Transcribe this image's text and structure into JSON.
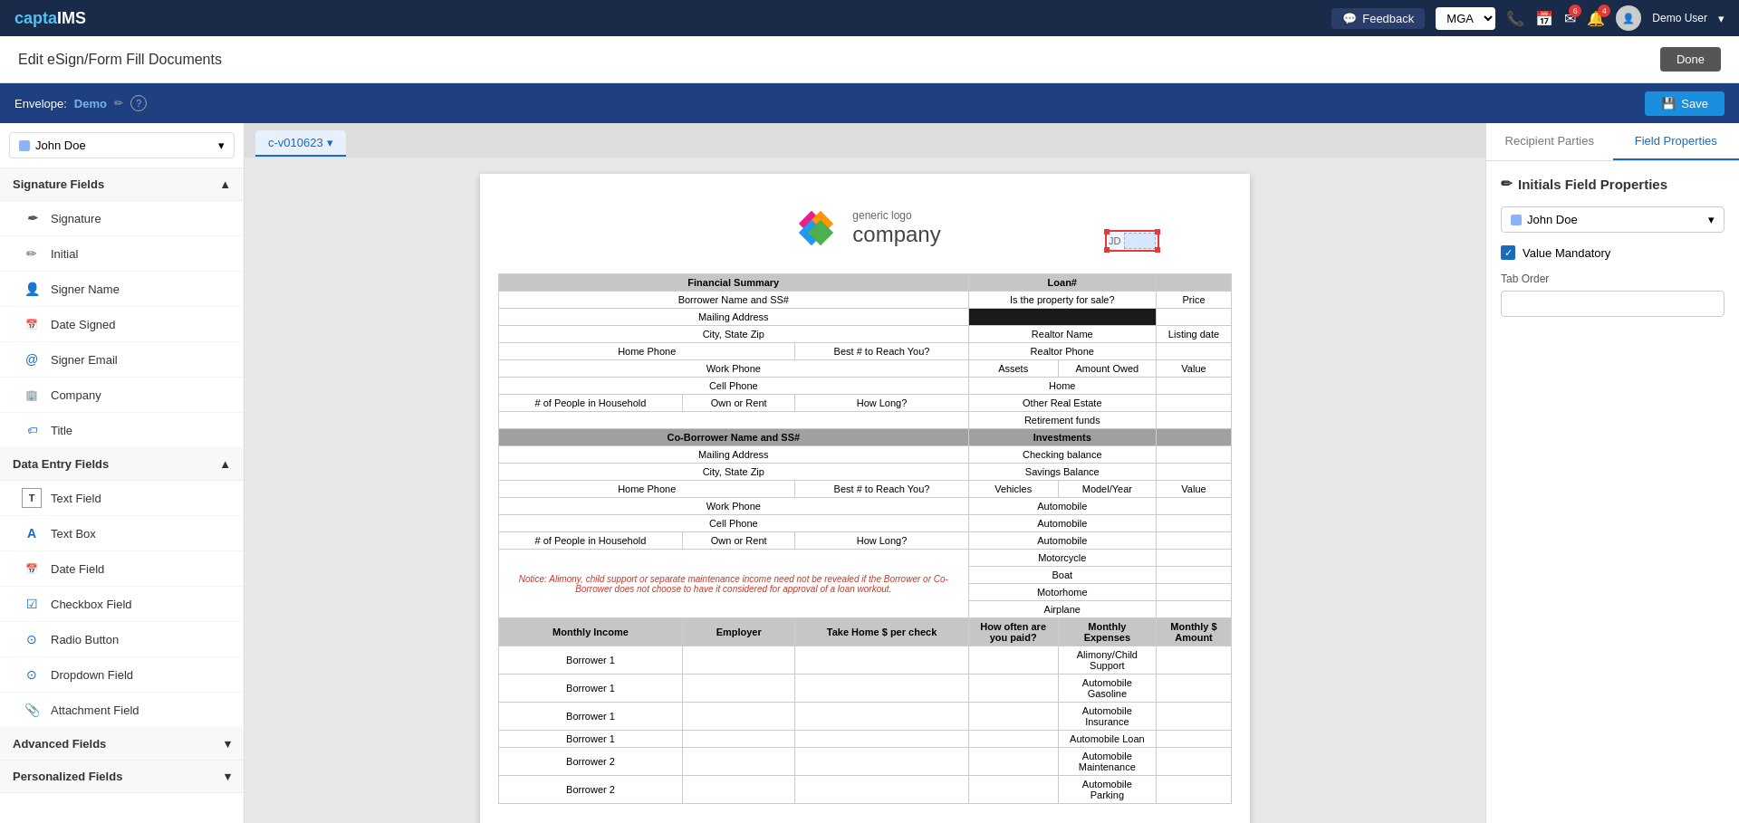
{
  "app": {
    "logo_prefix": "capta",
    "logo_suffix": "IMS"
  },
  "top_nav": {
    "feedback_label": "Feedback",
    "mga_label": "MGA",
    "user_label": "Demo User",
    "phone_badge": "",
    "calendar_badge": "",
    "email_badge": "6",
    "bell_badge": "4"
  },
  "page_header": {
    "title": "Edit eSign/Form Fill Documents",
    "done_button": "Done"
  },
  "envelope_bar": {
    "label": "Envelope:",
    "name": "Demo",
    "save_button": "Save",
    "help_icon": "?"
  },
  "left_sidebar": {
    "recipient": {
      "name": "John Doe",
      "color": "#8ab4f8"
    },
    "signature_fields": {
      "label": "Signature Fields",
      "items": [
        {
          "id": "signature",
          "label": "Signature",
          "icon": "✒"
        },
        {
          "id": "initial",
          "label": "Initial",
          "icon": "✏"
        },
        {
          "id": "signer-name",
          "label": "Signer Name",
          "icon": "👤"
        },
        {
          "id": "date-signed",
          "label": "Date Signed",
          "icon": "📅"
        },
        {
          "id": "signer-email",
          "label": "Signer Email",
          "icon": "📧"
        },
        {
          "id": "company",
          "label": "Company",
          "icon": "🏢"
        },
        {
          "id": "title",
          "label": "Title",
          "icon": "🏷"
        }
      ]
    },
    "data_entry_fields": {
      "label": "Data Entry Fields",
      "items": [
        {
          "id": "text-field",
          "label": "Text Field",
          "icon": "T"
        },
        {
          "id": "text-box",
          "label": "Text Box",
          "icon": "A"
        },
        {
          "id": "date-field",
          "label": "Date Field",
          "icon": "📅"
        },
        {
          "id": "checkbox-field",
          "label": "Checkbox Field",
          "icon": "☑"
        },
        {
          "id": "radio-button",
          "label": "Radio Button",
          "icon": "⊙"
        },
        {
          "id": "dropdown-field",
          "label": "Dropdown Field",
          "icon": "⊙"
        },
        {
          "id": "attachment-field",
          "label": "Attachment Field",
          "icon": "📎"
        }
      ]
    },
    "advanced_fields": {
      "label": "Advanced Fields",
      "expanded": false
    },
    "personalized_fields": {
      "label": "Personalized Fields",
      "expanded": false
    }
  },
  "tab_bar": {
    "tab_id": "c-v010623",
    "dropdown_icon": "▾"
  },
  "document": {
    "company_name": "company",
    "company_tagline": "generic logo",
    "initials_label": "JD",
    "table": {
      "section1_header": "Financial Summary",
      "loan_header": "Loan#",
      "rows_left": [
        "Borrower Name and SS#",
        "Mailing Address",
        "City, State Zip",
        "Home Phone",
        "Work Phone",
        "Cell Phone",
        "# of People in Household"
      ],
      "notice_text": "Notice: Alimony, child support or separate maintenance income need not be revealed if the Borrower or Co-Borrower does not choose to have it considered for approval of a loan workout.",
      "income_headers": [
        "Monthly Income",
        "Employer",
        "Take Home $ per check",
        "How often are you paid?",
        "Monthly Expenses",
        "Monthly $ Amount"
      ],
      "income_rows": [
        "Borrower 1",
        "Borrower 1",
        "Borrower 1",
        "Borrower 1",
        "Borrower 2",
        "Borrower 2"
      ]
    }
  },
  "right_panel": {
    "tabs": [
      {
        "id": "recipient-parties",
        "label": "Recipient Parties"
      },
      {
        "id": "field-properties",
        "label": "Field Properties"
      }
    ],
    "active_tab": "field-properties",
    "section_title": "Initials Field Properties",
    "recipient": {
      "name": "John Doe",
      "color": "#8ab4f8"
    },
    "value_mandatory_label": "Value Mandatory",
    "tab_order_label": "Tab Order",
    "tab_order_value": ""
  }
}
